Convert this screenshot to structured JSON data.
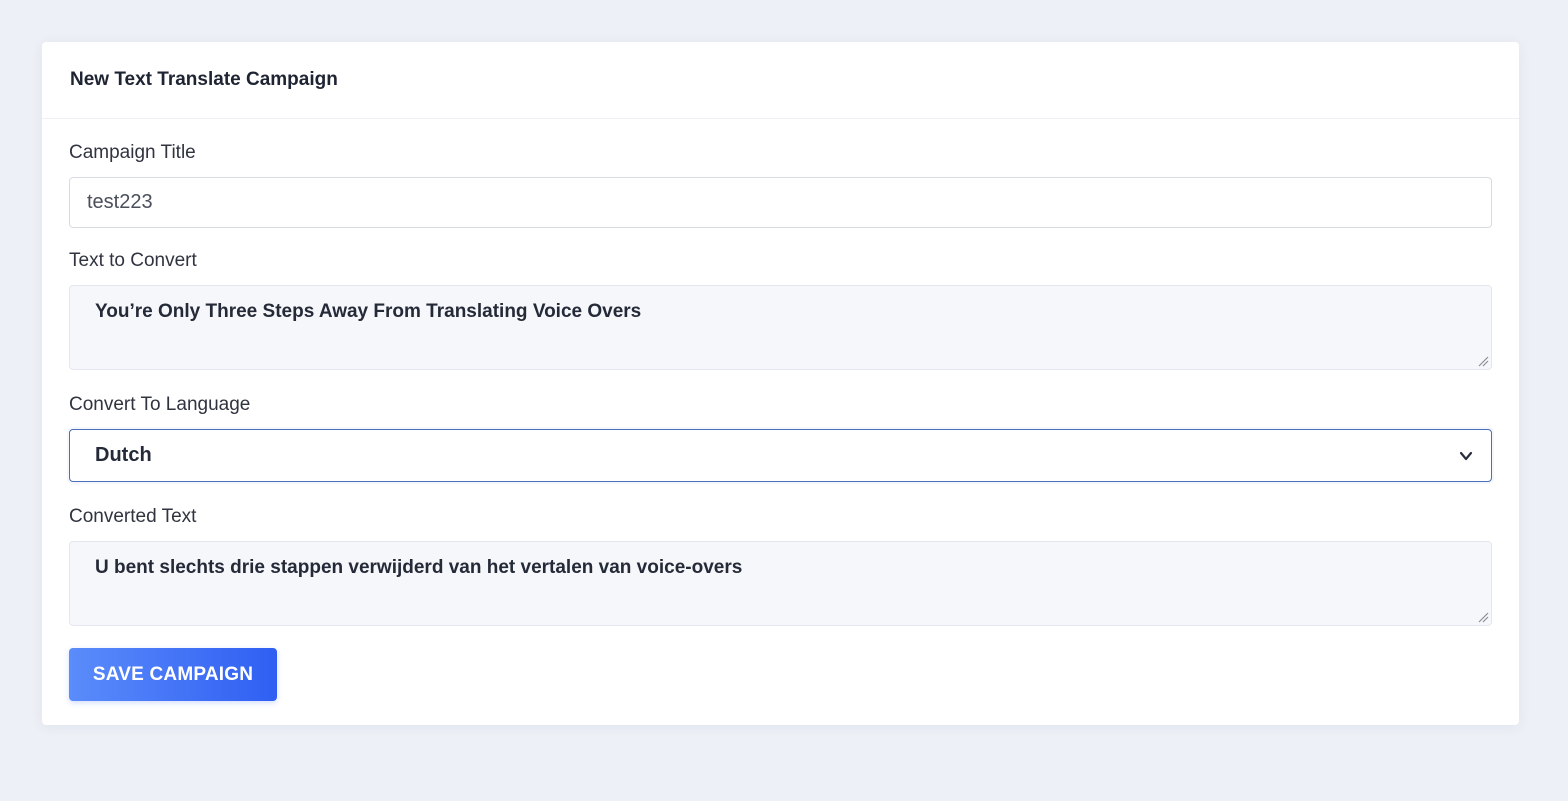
{
  "form": {
    "title": "New Text Translate Campaign",
    "campaign_title": {
      "label": "Campaign Title",
      "value": "test223"
    },
    "text_to_convert": {
      "label": "Text to Convert",
      "value": "You’re Only Three Steps Away From Translating Voice Overs"
    },
    "convert_to_language": {
      "label": "Convert To Language",
      "selected": "Dutch"
    },
    "converted_text": {
      "label": "Converted Text",
      "value": "U bent slechts drie stappen verwijderd van het vertalen van voice-overs"
    },
    "save_label": "SAVE CAMPAIGN"
  },
  "icons": {
    "select_arrow": "chevron-down-icon",
    "resize": "resize-handle-icon"
  },
  "colors": {
    "page_background": "#edf0f6",
    "card_background": "#ffffff",
    "button_gradient_start": "#5b8cfb",
    "button_gradient_end": "#2f5ff2",
    "select_focus_border": "#4a70b8",
    "textarea_background": "#f6f7fa"
  }
}
